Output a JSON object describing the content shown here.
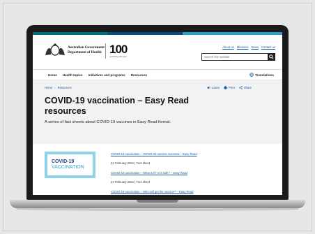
{
  "header": {
    "gov_line1": "Australian Government",
    "gov_line2": "Department of Health",
    "centenary": "100",
    "centenary_sub": "celebrating 100 years"
  },
  "utility_links": [
    "About us",
    "Ministers",
    "News",
    "Contact us"
  ],
  "search": {
    "placeholder": "Search this website"
  },
  "nav": {
    "items": [
      "Home",
      "Health topics",
      "Initiatives and programs",
      "Resources"
    ],
    "translations": "Translations"
  },
  "breadcrumb": [
    "Home",
    "Resources"
  ],
  "page_tools": {
    "listen": "Listen",
    "print": "Print",
    "share": "Share"
  },
  "page": {
    "title": "COVID-19 vaccination – Easy Read resources",
    "subtitle": "A series of fact sheets about COVID-19 vaccines in Easy Read format."
  },
  "thumbnail": {
    "line1": "COVID-19",
    "line2_a": "V",
    "line2_b": "ACCINATION"
  },
  "resources": [
    {
      "link": "COVID-19 vaccination – COVID-19 vaccine overview – Easy Read",
      "date": "22 February 2021",
      "type": "Fact sheet"
    },
    {
      "link": "COVID-19 vaccination – What is it? Is it safe? – Easy Read",
      "date": "22 February 2021",
      "type": "Fact sheet"
    },
    {
      "link": "COVID-19 vaccination – Who will get the vaccine? – Easy Read"
    }
  ],
  "colors": {
    "link": "#1a5aa0",
    "hero_bg": "#f2f2f2",
    "thumb_border": "#8fd3e8",
    "laptop": "#1b1b1b"
  }
}
